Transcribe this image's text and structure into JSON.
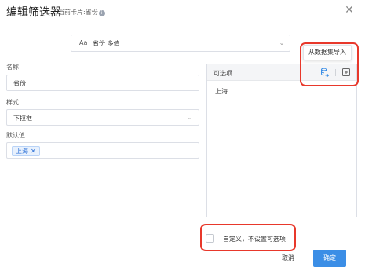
{
  "dialog": {
    "title": "编辑筛选器",
    "subtitle": "当前卡片:省份"
  },
  "field_selector": {
    "type_icon": "Aa",
    "value": "省份  多值"
  },
  "form": {
    "name_label": "名称",
    "name_value": "省份",
    "style_label": "样式",
    "style_value": "下拉框",
    "default_label": "默认值",
    "default_tag": "上海"
  },
  "options_panel": {
    "title": "可选项",
    "items": [
      "上海"
    ],
    "tooltip": "从数据集导入",
    "import_icon": "dataset-import-icon",
    "add_icon": "add-file-icon"
  },
  "custom_option": {
    "label": "自定义，不设置可选项",
    "checked": false
  },
  "buttons": {
    "cancel": "取消",
    "confirm": "确定"
  },
  "colors": {
    "primary": "#3b8ee6",
    "highlight": "#e8382b",
    "tag_text": "#2a6fd6"
  }
}
